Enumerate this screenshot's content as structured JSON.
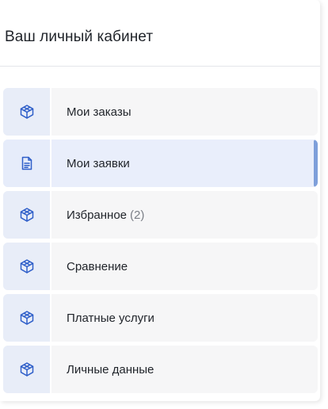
{
  "header": {
    "title": "Ваш личный кабинет"
  },
  "menu": {
    "accent_color": "#2f5fc9",
    "active_bar_color": "#7e9fda",
    "items": [
      {
        "label": "Мои заказы",
        "icon": "cube-icon",
        "active": false
      },
      {
        "label": "Мои заявки",
        "icon": "document-icon",
        "active": true
      },
      {
        "label": "Избранное",
        "count": "(2)",
        "icon": "cube-icon",
        "active": false
      },
      {
        "label": "Сравнение",
        "icon": "cube-icon",
        "active": false
      },
      {
        "label": "Платные услуги",
        "icon": "cube-icon",
        "active": false
      },
      {
        "label": "Личные данные",
        "icon": "cube-icon",
        "active": false
      }
    ]
  }
}
